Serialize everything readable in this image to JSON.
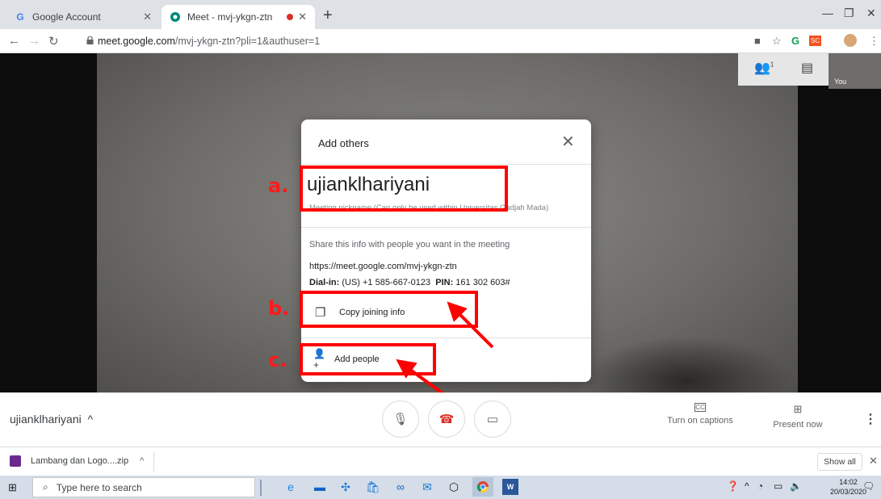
{
  "browser": {
    "tabs": [
      {
        "title": "Google Account",
        "favicon": "G"
      },
      {
        "title": "Meet - mvj-ykgn-ztn",
        "recording": true
      }
    ],
    "url_host": "meet.google.com",
    "url_path": "/mvj-ykgn-ztn?pli=1&authuser=1",
    "extension_badge": "SC"
  },
  "meet": {
    "self_label": "You",
    "participant_badge": "1"
  },
  "dialog": {
    "title": "Add others",
    "nickname": "ujianklhariyani",
    "nickname_note": "Meeting nickname (Can only be used within Universitas Gadjah Mada)",
    "share_text": "Share this info with people you want in the meeting",
    "meet_url": "https://meet.google.com/mvj-ykgn-ztn",
    "dialin_label": "Dial-in:",
    "dialin_value": "(US) +1 585-667-0123",
    "pin_label": "PIN:",
    "pin_value": "161 302 603#",
    "copy_label": "Copy joining info",
    "add_label": "Add people"
  },
  "annotations": {
    "a": "a.",
    "b": "b.",
    "c": "c.",
    "color": "#ff0000"
  },
  "controls": {
    "meeting_name": "ujianklhariyani",
    "captions_label": "Turn on captions",
    "captions_icon": "CC",
    "present_label": "Present now"
  },
  "download": {
    "file_name": "Lambang dan Logo....zip",
    "show_all": "Show all"
  },
  "taskbar": {
    "search_placeholder": "Type here to search",
    "time": "14:02",
    "date": "20/03/2020"
  }
}
